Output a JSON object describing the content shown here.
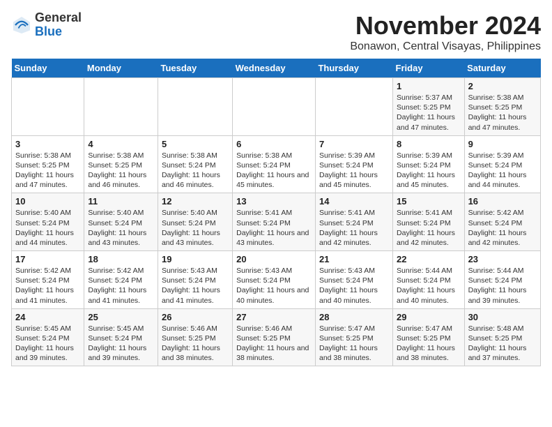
{
  "header": {
    "logo_line1": "General",
    "logo_line2": "Blue",
    "month": "November 2024",
    "location": "Bonawon, Central Visayas, Philippines"
  },
  "weekdays": [
    "Sunday",
    "Monday",
    "Tuesday",
    "Wednesday",
    "Thursday",
    "Friday",
    "Saturday"
  ],
  "weeks": [
    [
      {
        "day": "",
        "info": ""
      },
      {
        "day": "",
        "info": ""
      },
      {
        "day": "",
        "info": ""
      },
      {
        "day": "",
        "info": ""
      },
      {
        "day": "",
        "info": ""
      },
      {
        "day": "1",
        "info": "Sunrise: 5:37 AM\nSunset: 5:25 PM\nDaylight: 11 hours and 47 minutes."
      },
      {
        "day": "2",
        "info": "Sunrise: 5:38 AM\nSunset: 5:25 PM\nDaylight: 11 hours and 47 minutes."
      }
    ],
    [
      {
        "day": "3",
        "info": "Sunrise: 5:38 AM\nSunset: 5:25 PM\nDaylight: 11 hours and 47 minutes."
      },
      {
        "day": "4",
        "info": "Sunrise: 5:38 AM\nSunset: 5:25 PM\nDaylight: 11 hours and 46 minutes."
      },
      {
        "day": "5",
        "info": "Sunrise: 5:38 AM\nSunset: 5:24 PM\nDaylight: 11 hours and 46 minutes."
      },
      {
        "day": "6",
        "info": "Sunrise: 5:38 AM\nSunset: 5:24 PM\nDaylight: 11 hours and 45 minutes."
      },
      {
        "day": "7",
        "info": "Sunrise: 5:39 AM\nSunset: 5:24 PM\nDaylight: 11 hours and 45 minutes."
      },
      {
        "day": "8",
        "info": "Sunrise: 5:39 AM\nSunset: 5:24 PM\nDaylight: 11 hours and 45 minutes."
      },
      {
        "day": "9",
        "info": "Sunrise: 5:39 AM\nSunset: 5:24 PM\nDaylight: 11 hours and 44 minutes."
      }
    ],
    [
      {
        "day": "10",
        "info": "Sunrise: 5:40 AM\nSunset: 5:24 PM\nDaylight: 11 hours and 44 minutes."
      },
      {
        "day": "11",
        "info": "Sunrise: 5:40 AM\nSunset: 5:24 PM\nDaylight: 11 hours and 43 minutes."
      },
      {
        "day": "12",
        "info": "Sunrise: 5:40 AM\nSunset: 5:24 PM\nDaylight: 11 hours and 43 minutes."
      },
      {
        "day": "13",
        "info": "Sunrise: 5:41 AM\nSunset: 5:24 PM\nDaylight: 11 hours and 43 minutes."
      },
      {
        "day": "14",
        "info": "Sunrise: 5:41 AM\nSunset: 5:24 PM\nDaylight: 11 hours and 42 minutes."
      },
      {
        "day": "15",
        "info": "Sunrise: 5:41 AM\nSunset: 5:24 PM\nDaylight: 11 hours and 42 minutes."
      },
      {
        "day": "16",
        "info": "Sunrise: 5:42 AM\nSunset: 5:24 PM\nDaylight: 11 hours and 42 minutes."
      }
    ],
    [
      {
        "day": "17",
        "info": "Sunrise: 5:42 AM\nSunset: 5:24 PM\nDaylight: 11 hours and 41 minutes."
      },
      {
        "day": "18",
        "info": "Sunrise: 5:42 AM\nSunset: 5:24 PM\nDaylight: 11 hours and 41 minutes."
      },
      {
        "day": "19",
        "info": "Sunrise: 5:43 AM\nSunset: 5:24 PM\nDaylight: 11 hours and 41 minutes."
      },
      {
        "day": "20",
        "info": "Sunrise: 5:43 AM\nSunset: 5:24 PM\nDaylight: 11 hours and 40 minutes."
      },
      {
        "day": "21",
        "info": "Sunrise: 5:43 AM\nSunset: 5:24 PM\nDaylight: 11 hours and 40 minutes."
      },
      {
        "day": "22",
        "info": "Sunrise: 5:44 AM\nSunset: 5:24 PM\nDaylight: 11 hours and 40 minutes."
      },
      {
        "day": "23",
        "info": "Sunrise: 5:44 AM\nSunset: 5:24 PM\nDaylight: 11 hours and 39 minutes."
      }
    ],
    [
      {
        "day": "24",
        "info": "Sunrise: 5:45 AM\nSunset: 5:24 PM\nDaylight: 11 hours and 39 minutes."
      },
      {
        "day": "25",
        "info": "Sunrise: 5:45 AM\nSunset: 5:24 PM\nDaylight: 11 hours and 39 minutes."
      },
      {
        "day": "26",
        "info": "Sunrise: 5:46 AM\nSunset: 5:25 PM\nDaylight: 11 hours and 38 minutes."
      },
      {
        "day": "27",
        "info": "Sunrise: 5:46 AM\nSunset: 5:25 PM\nDaylight: 11 hours and 38 minutes."
      },
      {
        "day": "28",
        "info": "Sunrise: 5:47 AM\nSunset: 5:25 PM\nDaylight: 11 hours and 38 minutes."
      },
      {
        "day": "29",
        "info": "Sunrise: 5:47 AM\nSunset: 5:25 PM\nDaylight: 11 hours and 38 minutes."
      },
      {
        "day": "30",
        "info": "Sunrise: 5:48 AM\nSunset: 5:25 PM\nDaylight: 11 hours and 37 minutes."
      }
    ]
  ]
}
